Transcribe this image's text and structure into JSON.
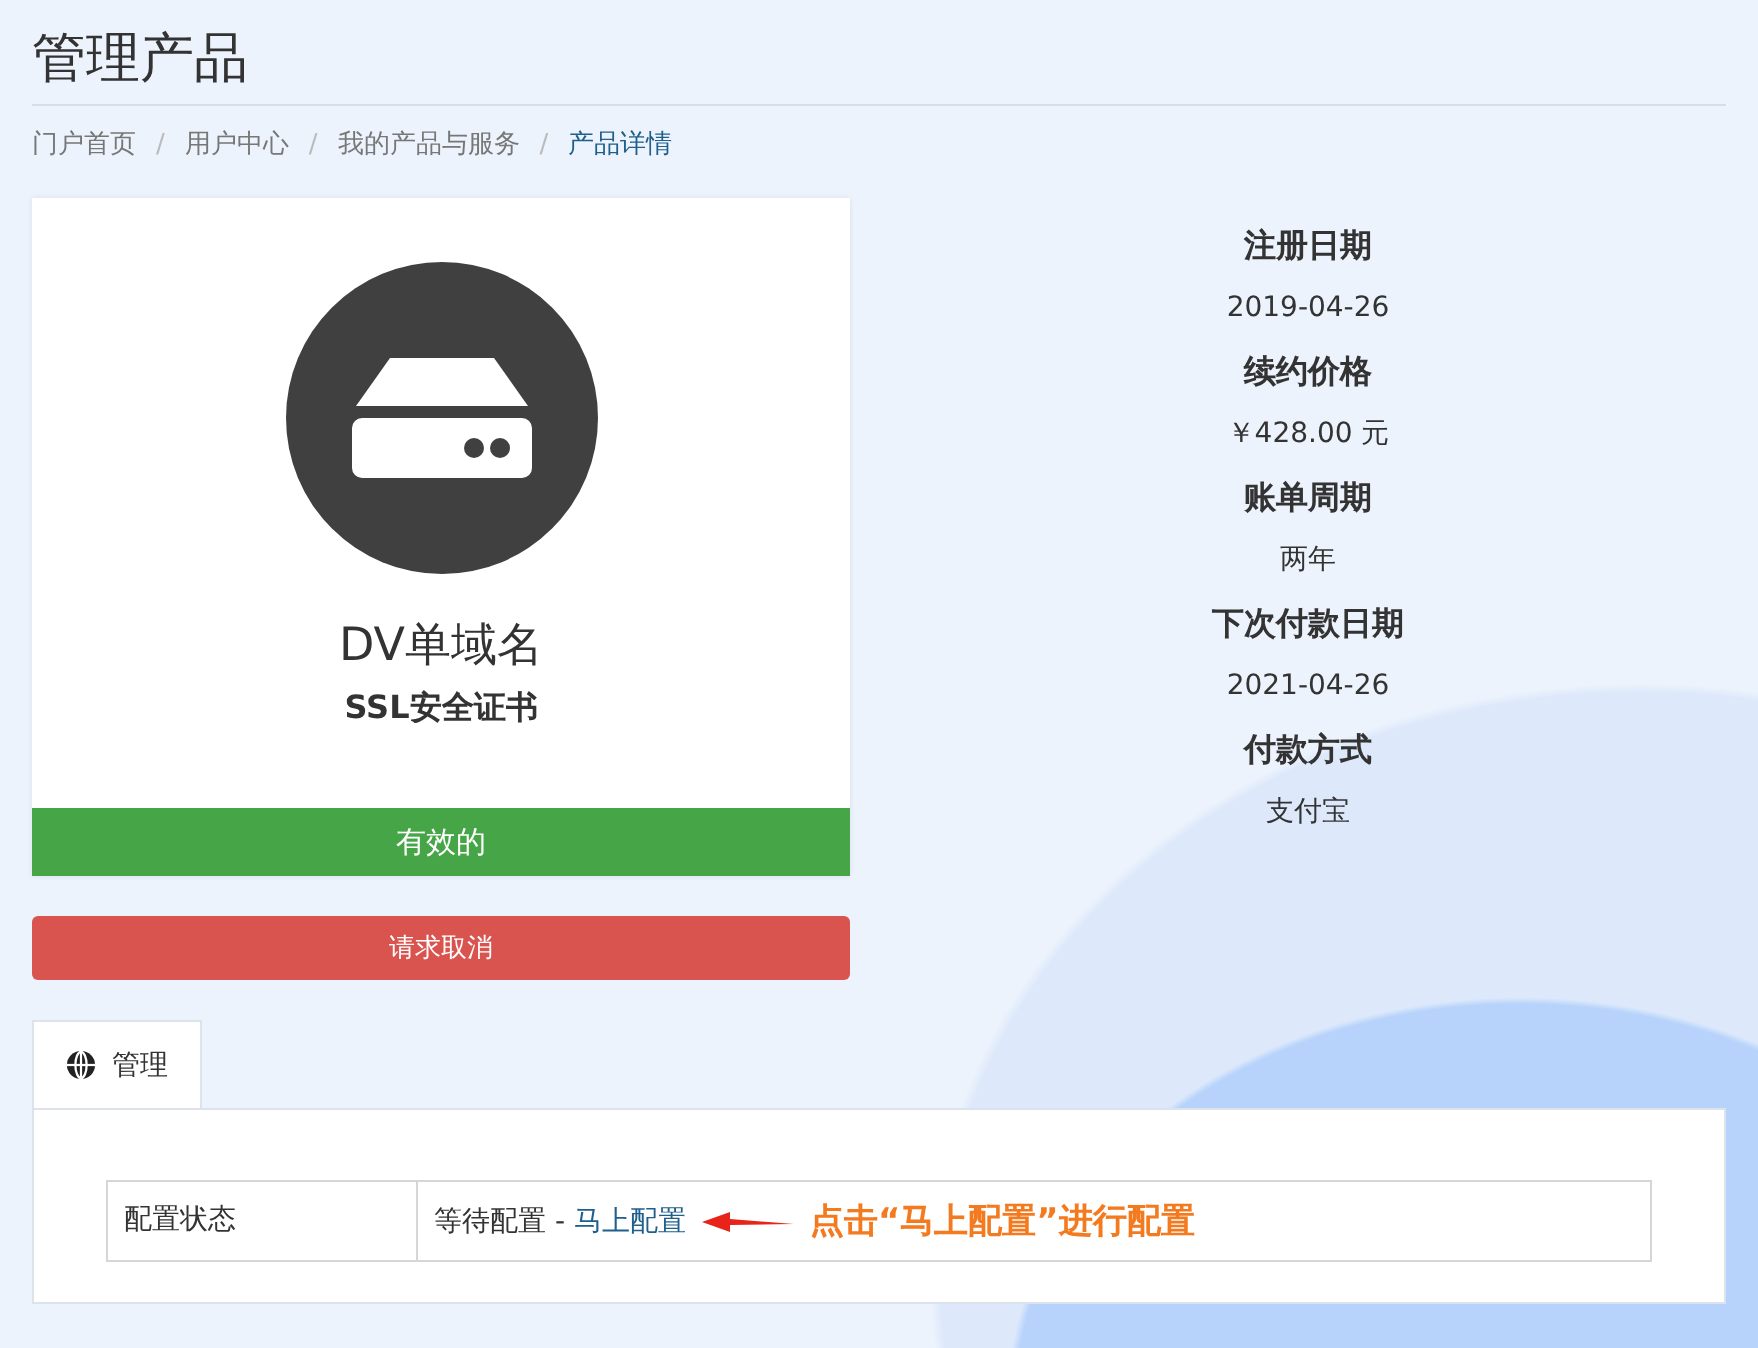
{
  "page_title": "管理产品",
  "breadcrumb_separator": "/",
  "breadcrumb": [
    {
      "label": "门户首页",
      "selected": false
    },
    {
      "label": "用户中心",
      "selected": false
    },
    {
      "label": "我的产品与服务",
      "selected": false
    },
    {
      "label": "产品详情",
      "selected": true
    }
  ],
  "product": {
    "name": "DV单域名",
    "group": "SSL安全证书",
    "status": {
      "label": "有效的",
      "kind": "active"
    }
  },
  "cancel_button": "请求取消",
  "details": [
    {
      "label": "注册日期",
      "value": "2019-04-26"
    },
    {
      "label": "续约价格",
      "value": "￥428.00 元"
    },
    {
      "label": "账单周期",
      "value": "两年"
    },
    {
      "label": "下次付款日期",
      "value": "2021-04-26"
    },
    {
      "label": "付款方式",
      "value": "支付宝"
    }
  ],
  "tabs": [
    {
      "label": "管理",
      "selected": true
    }
  ],
  "config_table": {
    "label": "配置状态",
    "status": "等待配置 - ",
    "link": "马上配置"
  },
  "annotation": "点击“马上配置”进行配置"
}
